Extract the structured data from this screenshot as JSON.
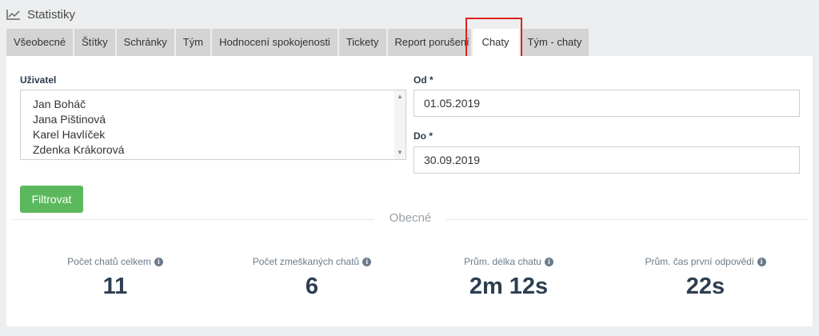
{
  "page": {
    "title": "Statistiky",
    "title_icon": "line-chart-icon"
  },
  "tabs": [
    {
      "label": "Všeobecné",
      "active": false
    },
    {
      "label": "Štítky",
      "active": false
    },
    {
      "label": "Schránky",
      "active": false
    },
    {
      "label": "Tým",
      "active": false
    },
    {
      "label": "Hodnocení spokojenosti",
      "active": false
    },
    {
      "label": "Tickety",
      "active": false
    },
    {
      "label": "Report porušení",
      "active": false
    },
    {
      "label": "Chaty",
      "active": true
    },
    {
      "label": "Tým - chaty",
      "active": false
    }
  ],
  "filter": {
    "user_label": "Uživatel",
    "users": [
      "Jan Boháč",
      "Jana Pištinová",
      "Karel Havlíček",
      "Zdenka Krákorová"
    ],
    "from_label": "Od *",
    "from_value": "01.05.2019",
    "to_label": "Do *",
    "to_value": "30.09.2019",
    "button_label": "Filtrovat"
  },
  "section": {
    "title": "Obecné"
  },
  "stats": [
    {
      "label": "Počet chatů celkem",
      "value": "11"
    },
    {
      "label": "Počet zmeškaných chatů",
      "value": "6"
    },
    {
      "label": "Prům. délka chatu",
      "value": "2m 12s"
    },
    {
      "label": "Prům. čas první odpovědi",
      "value": "22s"
    }
  ],
  "colors": {
    "accent_button": "#5cb85c",
    "highlight": "#e02020",
    "tab_bg": "#d4d4d4",
    "stat_value": "#2d3e50"
  }
}
